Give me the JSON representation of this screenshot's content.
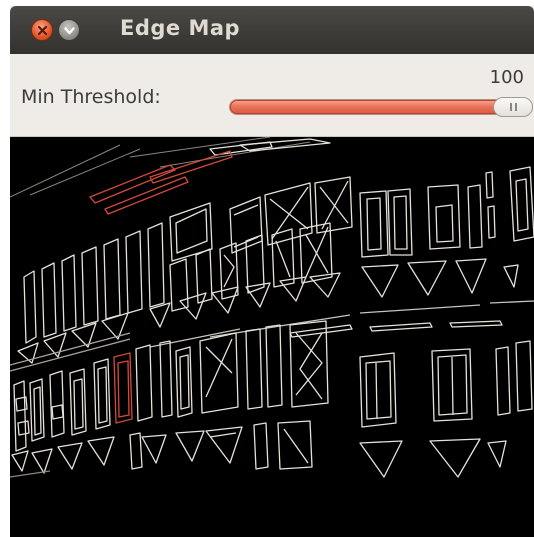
{
  "window": {
    "title": "Edge Map"
  },
  "titlebar": {
    "close_icon": "close-icon",
    "minimize_icon": "chevron-down-icon"
  },
  "controls": {
    "threshold_label": "Min Threshold:",
    "threshold_value": "100",
    "slider_fraction": 1.0
  },
  "colors": {
    "titlebar": "#3c3b37",
    "close_button": "#e2542a",
    "slider_fill": "#e96f55",
    "window_bg": "#efebe7",
    "edge_stroke": "#e8e4dc",
    "edge_red": "#d34a3a"
  }
}
